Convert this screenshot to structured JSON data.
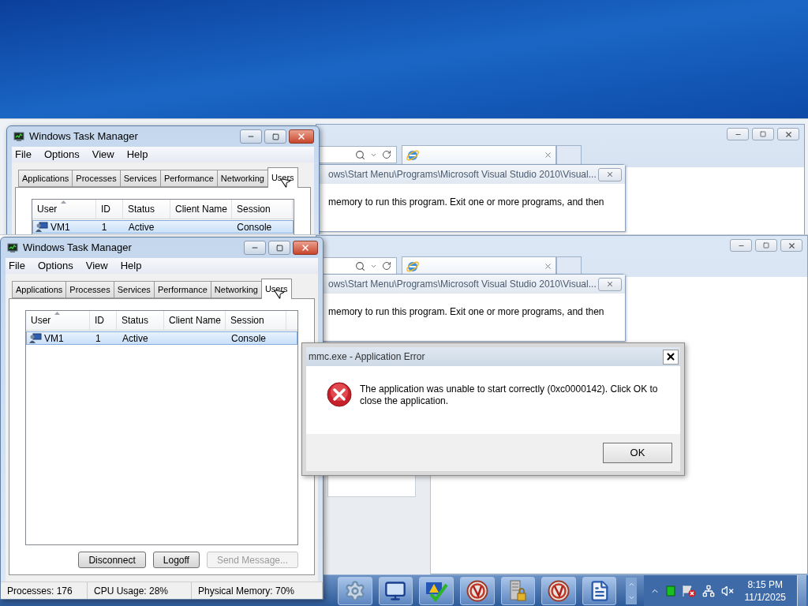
{
  "top_capture": {
    "task_manager": {
      "title": "Windows Task Manager",
      "menu": [
        "File",
        "Options",
        "View",
        "Help"
      ],
      "tabs": [
        {
          "label": "Applications",
          "selected": false
        },
        {
          "label": "Processes",
          "selected": false
        },
        {
          "label": "Services",
          "selected": false
        },
        {
          "label": "Performance",
          "selected": false
        },
        {
          "label": "Networking",
          "selected": false
        },
        {
          "label": "Users",
          "selected": true
        }
      ],
      "columns": [
        {
          "label": "User",
          "sorted": true
        },
        {
          "label": "ID",
          "sorted": false
        },
        {
          "label": "Status",
          "sorted": false
        },
        {
          "label": "Client Name",
          "sorted": false
        },
        {
          "label": "Session",
          "sorted": false
        }
      ],
      "rows": [
        {
          "user": "VM1",
          "id": "1",
          "status": "Active",
          "session": "Console",
          "selected": true
        }
      ]
    },
    "background_window": {
      "path": "ows\\Start Menu\\Programs\\Microsoft Visual Studio 2010\\Visual...",
      "message": "memory to run this program. Exit one or more programs, and then"
    }
  },
  "main": {
    "task_manager": {
      "title": "Windows Task Manager",
      "menu": [
        "File",
        "Options",
        "View",
        "Help"
      ],
      "tabs": [
        {
          "label": "Applications",
          "selected": false
        },
        {
          "label": "Processes",
          "selected": false
        },
        {
          "label": "Services",
          "selected": false
        },
        {
          "label": "Performance",
          "selected": false
        },
        {
          "label": "Networking",
          "selected": false
        },
        {
          "label": "Users",
          "selected": true
        }
      ],
      "columns": [
        {
          "label": "User",
          "sorted": true
        },
        {
          "label": "ID",
          "sorted": false
        },
        {
          "label": "Status",
          "sorted": false
        },
        {
          "label": "Client Name",
          "sorted": false
        },
        {
          "label": "Session",
          "sorted": false
        }
      ],
      "rows": [
        {
          "user": "VM1",
          "id": "1",
          "status": "Active",
          "session": "Console",
          "selected": true
        }
      ],
      "buttons": [
        {
          "label": "Disconnect",
          "disabled": false
        },
        {
          "label": "Logoff",
          "disabled": false
        },
        {
          "label": "Send Message...",
          "disabled": true
        }
      ],
      "status_bar": [
        "Processes: 176",
        "CPU Usage: 28%",
        "Physical Memory: 70%"
      ]
    },
    "background_window": {
      "path": "ows\\Start Menu\\Programs\\Microsoft Visual Studio 2010\\Visual...",
      "message": "memory to run this program. Exit one or more programs, and then"
    },
    "error_dialog": {
      "title": "mmc.exe - Application Error",
      "message": "The application was unable to start correctly (0xc0000142). Click OK to close the application.",
      "button": "OK"
    },
    "taskbar": {
      "time": "8:15 PM",
      "date": "11/1/2025"
    }
  }
}
